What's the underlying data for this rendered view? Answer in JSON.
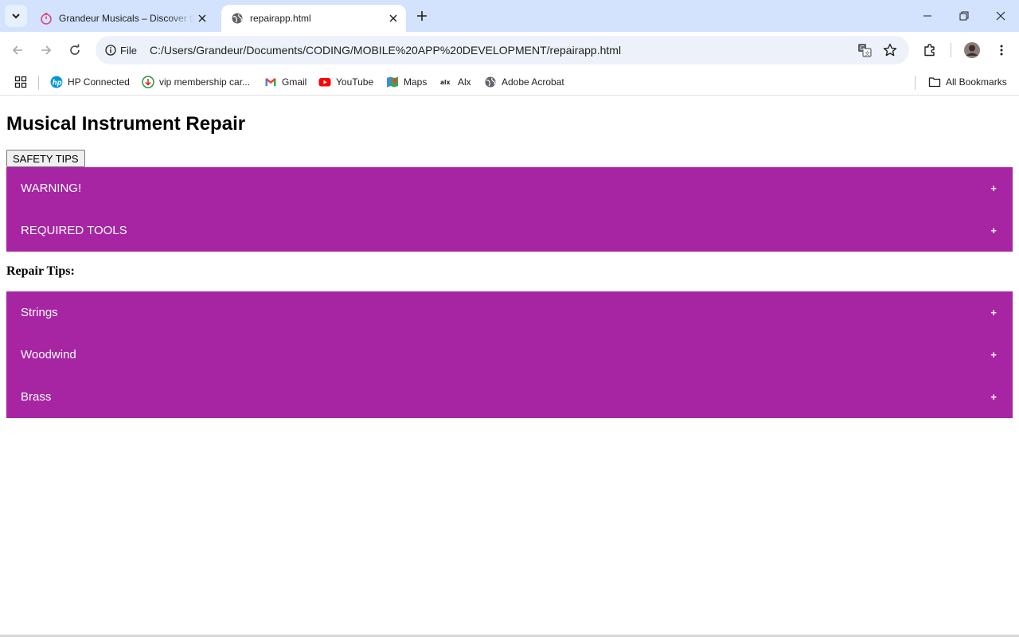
{
  "browser": {
    "tabs": [
      {
        "title": "Grandeur Musicals – Discover the"
      },
      {
        "title": "repairapp.html"
      }
    ],
    "omnibox": {
      "chip_label": "File",
      "url": "C:/Users/Grandeur/Documents/CODING/MOBILE%20APP%20DEVELOPMENT/repairapp.html"
    },
    "bookmarks": [
      {
        "label": "HP Connected",
        "icon": "hp-icon"
      },
      {
        "label": "vip membership car...",
        "icon": "download-circle-icon"
      },
      {
        "label": "Gmail",
        "icon": "gmail-icon"
      },
      {
        "label": "YouTube",
        "icon": "youtube-icon"
      },
      {
        "label": "Maps",
        "icon": "maps-icon"
      },
      {
        "label": "Alx",
        "icon": "alx-icon"
      },
      {
        "label": "Adobe Acrobat",
        "icon": "globe-icon"
      }
    ],
    "all_bookmarks_label": "All Bookmarks"
  },
  "page": {
    "title": "Musical Instrument Repair",
    "safety_button": "SAFETY TIPS",
    "safety_items": [
      {
        "label": "WARNING!",
        "toggle": "+"
      },
      {
        "label": "REQUIRED TOOLS",
        "toggle": "+"
      }
    ],
    "repair_heading": "Repair Tips:",
    "repair_items": [
      {
        "label": "Strings",
        "toggle": "+"
      },
      {
        "label": "Woodwind",
        "toggle": "+"
      },
      {
        "label": "Brass",
        "toggle": "+"
      }
    ]
  },
  "colors": {
    "accordion_bg": "#a724a3",
    "tabstrip_bg": "#d3e3fd",
    "omnibox_bg": "#edf2fa"
  }
}
